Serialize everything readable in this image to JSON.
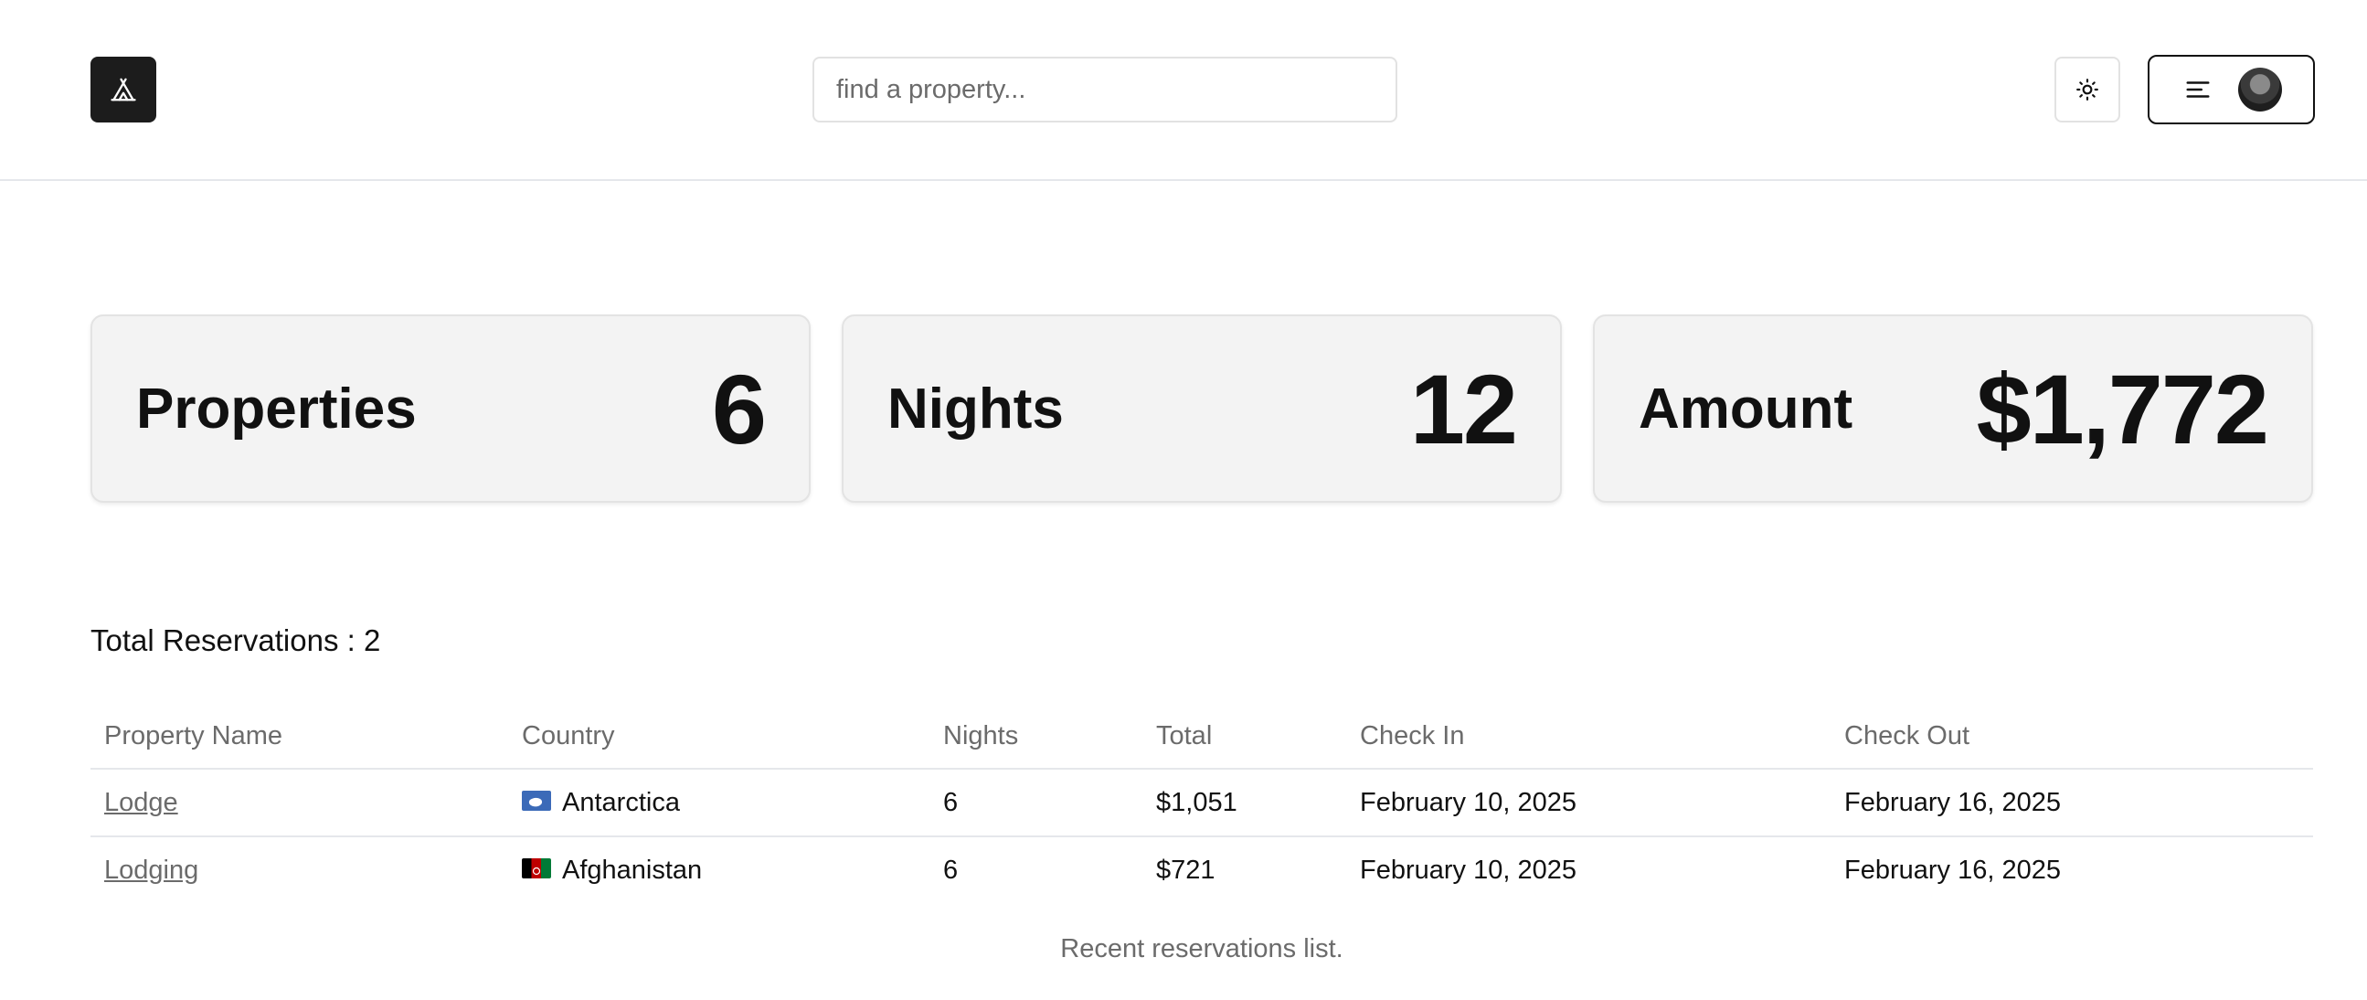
{
  "header": {
    "logo_icon": "tent-icon",
    "search": {
      "placeholder": "find a property..."
    },
    "theme_toggle_icon": "sun-icon",
    "menu_icon": "menu-icon"
  },
  "stats": [
    {
      "label": "Properties",
      "value": "6"
    },
    {
      "label": "Nights",
      "value": "12"
    },
    {
      "label": "Amount",
      "value": "$1,772"
    }
  ],
  "reservations": {
    "total_label": "Total Reservations : 2",
    "columns": [
      "Property Name",
      "Country",
      "Nights",
      "Total",
      "Check In",
      "Check Out"
    ],
    "rows": [
      {
        "property": "Lodge",
        "flag_icon": "antarctica-flag-icon",
        "country": "Antarctica",
        "nights": "6",
        "total": "$1,051",
        "check_in": "February 10, 2025",
        "check_out": "February 16, 2025"
      },
      {
        "property": "Lodging",
        "flag_icon": "afghanistan-flag-icon",
        "country": "Afghanistan",
        "nights": "6",
        "total": "$721",
        "check_in": "February 10, 2025",
        "check_out": "February 16, 2025"
      }
    ],
    "caption": "Recent reservations list."
  }
}
